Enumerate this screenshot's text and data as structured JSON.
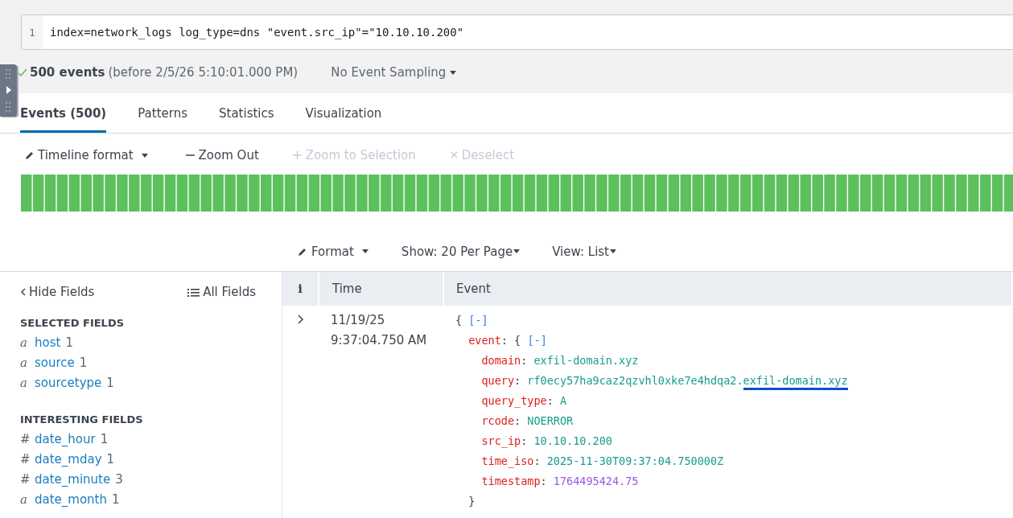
{
  "search": {
    "line_number": "1",
    "query": "index=network_logs log_type=dns \"event.src_ip\"=\"10.10.10.200\""
  },
  "status": {
    "count": "500 events",
    "range": "(before 2/5/26 5:10:01.000 PM)",
    "sampling": "No Event Sampling"
  },
  "tabs": [
    {
      "label": "Events (500)",
      "selected": true
    },
    {
      "label": "Patterns",
      "selected": false
    },
    {
      "label": "Statistics",
      "selected": false
    },
    {
      "label": "Visualization",
      "selected": false
    }
  ],
  "timeline_toolbar": [
    {
      "kind": "format",
      "label": "Timeline format",
      "disabled": false
    },
    {
      "kind": "zoom-out",
      "label": "Zoom Out",
      "disabled": false
    },
    {
      "kind": "zoom-in",
      "label": "Zoom to Selection",
      "disabled": true
    },
    {
      "kind": "deselect",
      "label": "Deselect",
      "disabled": true
    }
  ],
  "results_toolbar": [
    {
      "kind": "format",
      "label": "Format"
    },
    {
      "kind": "menu",
      "label": "Show: 20 Per Page"
    },
    {
      "kind": "menu",
      "label": "View: List"
    }
  ],
  "fields_panel": {
    "hide_label": "Hide Fields",
    "all_label": "All Fields",
    "sections": [
      {
        "title": "SELECTED FIELDS",
        "fields": [
          {
            "type_icon": "a",
            "name": "host",
            "count": "1"
          },
          {
            "type_icon": "a",
            "name": "source",
            "count": "1"
          },
          {
            "type_icon": "a",
            "name": "sourcetype",
            "count": "1"
          }
        ]
      },
      {
        "title": "INTERESTING FIELDS",
        "fields": [
          {
            "type_icon": "#",
            "name": "date_hour",
            "count": "1"
          },
          {
            "type_icon": "#",
            "name": "date_mday",
            "count": "1"
          },
          {
            "type_icon": "#",
            "name": "date_minute",
            "count": "3"
          },
          {
            "type_icon": "a",
            "name": "date_month",
            "count": "1"
          }
        ]
      }
    ]
  },
  "events_table": {
    "columns": [
      "i",
      "Time",
      "Event"
    ],
    "rows": [
      {
        "expanded": false,
        "time": [
          "11/19/25",
          "9:37:04.750 AM"
        ],
        "lines": [
          {
            "kind": "open",
            "text": "{",
            "toggle": "[-]"
          },
          {
            "kind": "object",
            "key": "event",
            "punct": ":",
            "text": "{",
            "toggle": "[-]"
          },
          {
            "kind": "string",
            "key": "domain",
            "punct": ":",
            "value": "exfil-domain.xyz"
          },
          {
            "kind": "string",
            "key": "query",
            "punct": ":",
            "value": "rf0ecy57ha9caz2qzvhl0xke7e4hdqa2.",
            "highlight": "exfil-domain.xyz"
          },
          {
            "kind": "string",
            "key": "query_type",
            "punct": ":",
            "value": "A"
          },
          {
            "kind": "string",
            "key": "rcode",
            "punct": ":",
            "value": "NOERROR"
          },
          {
            "kind": "string",
            "key": "src_ip",
            "punct": ":",
            "value": "10.10.10.200"
          },
          {
            "kind": "string",
            "key": "time_iso",
            "punct": ":",
            "value": "2025-11-30T09:37:04.750000Z"
          },
          {
            "kind": "number",
            "key": "timestamp",
            "punct": ":",
            "value": "1764495424.75"
          },
          {
            "kind": "close",
            "text": "}"
          }
        ]
      }
    ]
  }
}
